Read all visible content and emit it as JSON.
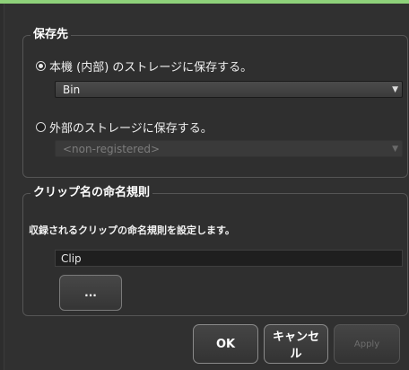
{
  "save_destination": {
    "title": "保存先",
    "internal_option": {
      "label": "本機 (内部) のストレージに保存する。",
      "selected": true
    },
    "internal_select_value": "Bin",
    "external_option": {
      "label": "外部のストレージに保存する。",
      "selected": false
    },
    "external_select_value": "<non-registered>"
  },
  "clip_naming": {
    "title": "クリップ名の命名規則",
    "description": "収録されるクリップの命名規則を設定します。",
    "name_value": "Clip",
    "browse_label": "..."
  },
  "footer": {
    "ok_label": "OK",
    "cancel_label": "キャンセル",
    "apply_label": "Apply"
  },
  "colors": {
    "accent_line": "#8ed17a",
    "background": "#303030"
  }
}
